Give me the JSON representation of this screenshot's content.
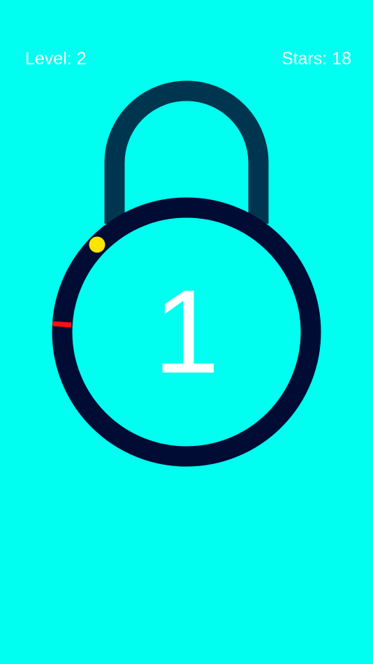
{
  "hud": {
    "level_label": "Level: 2",
    "stars_label": "Stars: 18"
  },
  "lock": {
    "remaining_taps": "1"
  },
  "colors": {
    "background": "#00FFF0",
    "shackle": "#00354F",
    "ring": "#000C33",
    "dot": "#FFE400",
    "marker": "#FF1010",
    "text": "#FFFFFF"
  }
}
